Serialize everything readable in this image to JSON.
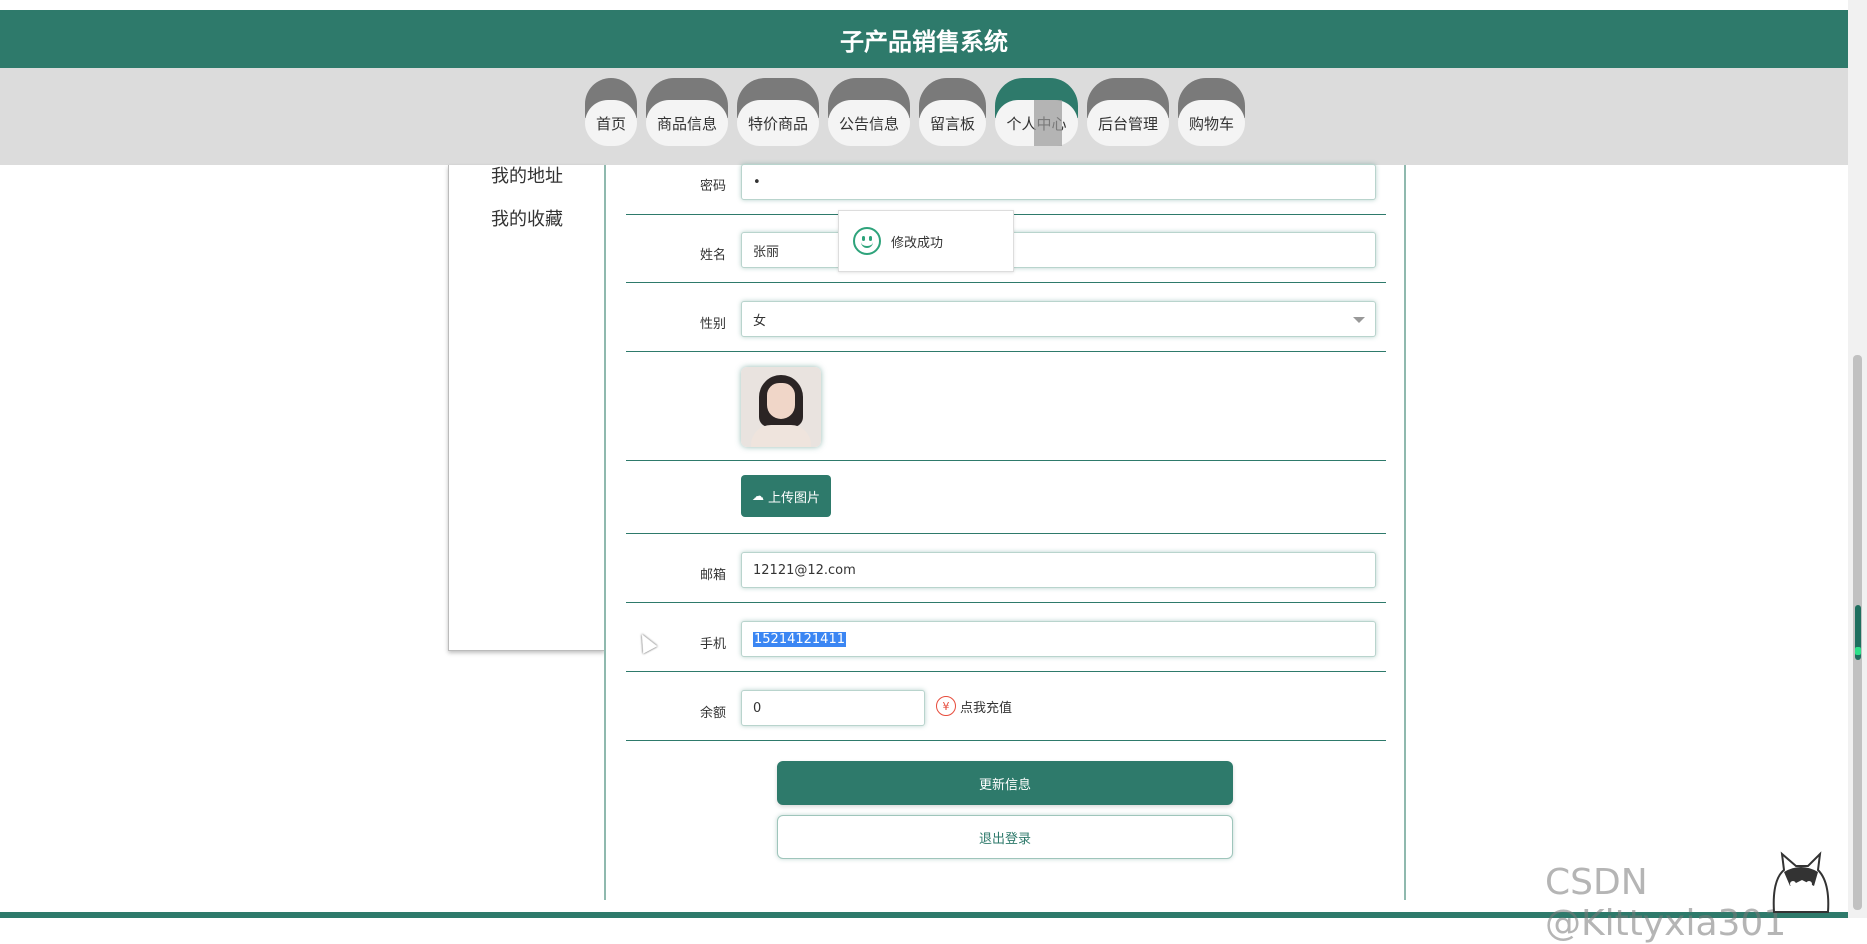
{
  "header": {
    "title": "子产品销售系统"
  },
  "nav": {
    "tabs": [
      {
        "label": "首页"
      },
      {
        "label": "商品信息"
      },
      {
        "label": "特价商品"
      },
      {
        "label": "公告信息"
      },
      {
        "label": "留言板"
      },
      {
        "label": "个人中心"
      },
      {
        "label": "后台管理"
      },
      {
        "label": "购物车"
      }
    ],
    "active_index": 5
  },
  "sidebar": {
    "items": [
      {
        "label": "我的地址"
      },
      {
        "label": "我的收藏"
      }
    ]
  },
  "form": {
    "password": {
      "label": "密码",
      "value": "•"
    },
    "name": {
      "label": "姓名",
      "value": "张丽"
    },
    "gender": {
      "label": "性别",
      "value": "女"
    },
    "upload_label": "上传图片",
    "email": {
      "label": "邮箱",
      "value": "12121@12.com"
    },
    "phone": {
      "label": "手机",
      "value": "15214121411"
    },
    "balance": {
      "label": "余额",
      "value": "0",
      "recharge_label": "点我充值",
      "recharge_icon": "¥"
    },
    "update_button": "更新信息",
    "logout_button": "退出登录"
  },
  "toast": {
    "message": "修改成功"
  },
  "watermark": "CSDN @Kittyxia301",
  "colors": {
    "primary": "#2e7a6b",
    "nav_bg": "#dcdcdc",
    "selection": "#3b86f3"
  }
}
